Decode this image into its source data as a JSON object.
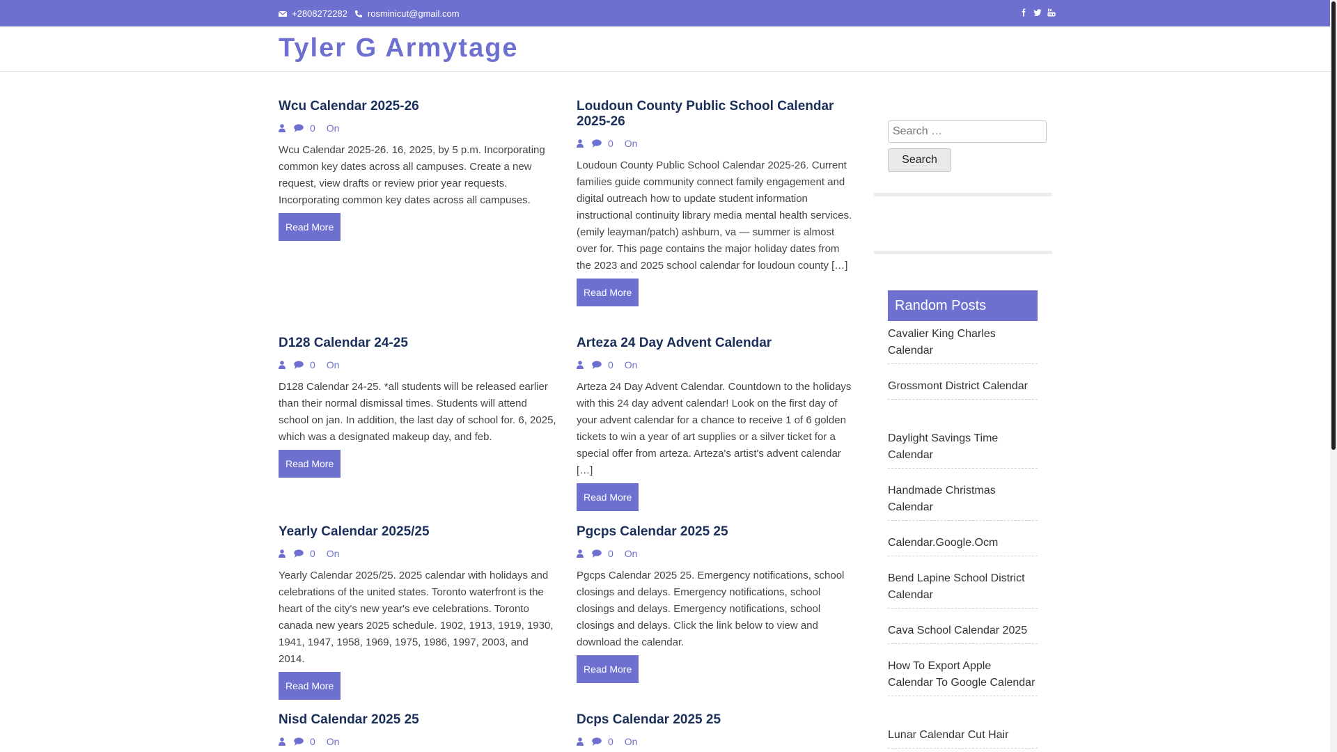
{
  "topbar": {
    "phone": "+2808272282",
    "email": "rosminicut@gmail.com",
    "social_icons": [
      "facebook-icon",
      "twitter-icon",
      "youtube-icon"
    ]
  },
  "site": {
    "title": "Tyler G Armytage"
  },
  "colors": {
    "accent": "#6e70cf",
    "heading": "#1b2f5b"
  },
  "posts": [
    {
      "title": "Wcu Calendar 2025-26",
      "comments": "0",
      "on": "On",
      "excerpt": "Wcu Calendar 2025-26. 16, 2025, by 5 p.m. Incorporating common key dates across all campuses. Create a new request, view drafts or review prior year requests. Incorporating common key dates across all campuses.",
      "read_more": "Read More"
    },
    {
      "title": "Loudoun County Public School Calendar 2025-26",
      "comments": "0",
      "on": "On",
      "excerpt": "Loudoun County Public School Calendar 2025-26. Current families guide community connect family engagement and digital outreach how to update student information instructional continuity library media mental health services. (emily leayman/patch) ashburn, va — summer is almost over for. This page contains the major holiday dates from the 2023 and 2025 school calendar for loudoun county […]",
      "read_more": "Read More"
    },
    {
      "title": "D128 Calendar 24-25",
      "comments": "0",
      "on": "On",
      "excerpt": "D128 Calendar 24-25. *all students will be released earlier than their normal dismissal times. Students will attend school on jan. In addition, the last day of school for. 6, 2025, which was a designated makeup day, and feb.",
      "read_more": "Read More"
    },
    {
      "title": "Arteza 24 Day Advent Calendar",
      "comments": "0",
      "on": "On",
      "excerpt": "Arteza 24 Day Advent Calendar. Countdown to the holidays with this 24 day advent calendar! Look on the first day of your advent calendar for a chance to receive 1 of 6 golden tickets to win a year of art supplies or a silver ticket for a special offer from arteza. Arteza's artist's advent calendar […]",
      "read_more": "Read More"
    },
    {
      "title": "Yearly Calendar 2025/25",
      "comments": "0",
      "on": "On",
      "excerpt": "Yearly Calendar 2025/25. 2025 calendar with holidays and celebrations of the united states. Toronto waterfront is the heart of the city's new year's eve celebrations. Toronto canada new years 2025 schedule. 1902, 1913, 1919, 1930, 1941, 1947, 1958, 1969, 1975, 1986, 1997, 2003, and 2014.",
      "read_more": "Read More"
    },
    {
      "title": "Pgcps Calendar 2025 25",
      "comments": "0",
      "on": "On",
      "excerpt": "Pgcps Calendar 2025 25. Emergency notifications, school closings and delays. Emergency notifications, school closings and delays. Emergency notifications, school closings and delays. Click the link below to view and download the calendar.",
      "read_more": "Read More"
    },
    {
      "title": "Nisd Calendar 2025 25",
      "comments": "0",
      "on": "On"
    },
    {
      "title": "Dcps Calendar 2025 25",
      "comments": "0",
      "on": "On"
    }
  ],
  "sidebar": {
    "search_placeholder": "Search …",
    "search_button": "Search",
    "random_posts_title": "Random Posts",
    "random_posts": [
      "Cavalier King Charles Calendar",
      "Grossmont District Calendar",
      "Daylight Savings Time Calendar",
      "Handmade Christmas Calendar",
      "Calendar.Google.Ocm",
      "Bend Lapine School District Calendar",
      "Cava School Calendar 2025",
      "How To Export Apple Calendar To Google Calendar",
      "Lunar Calendar Cut Hair"
    ]
  }
}
